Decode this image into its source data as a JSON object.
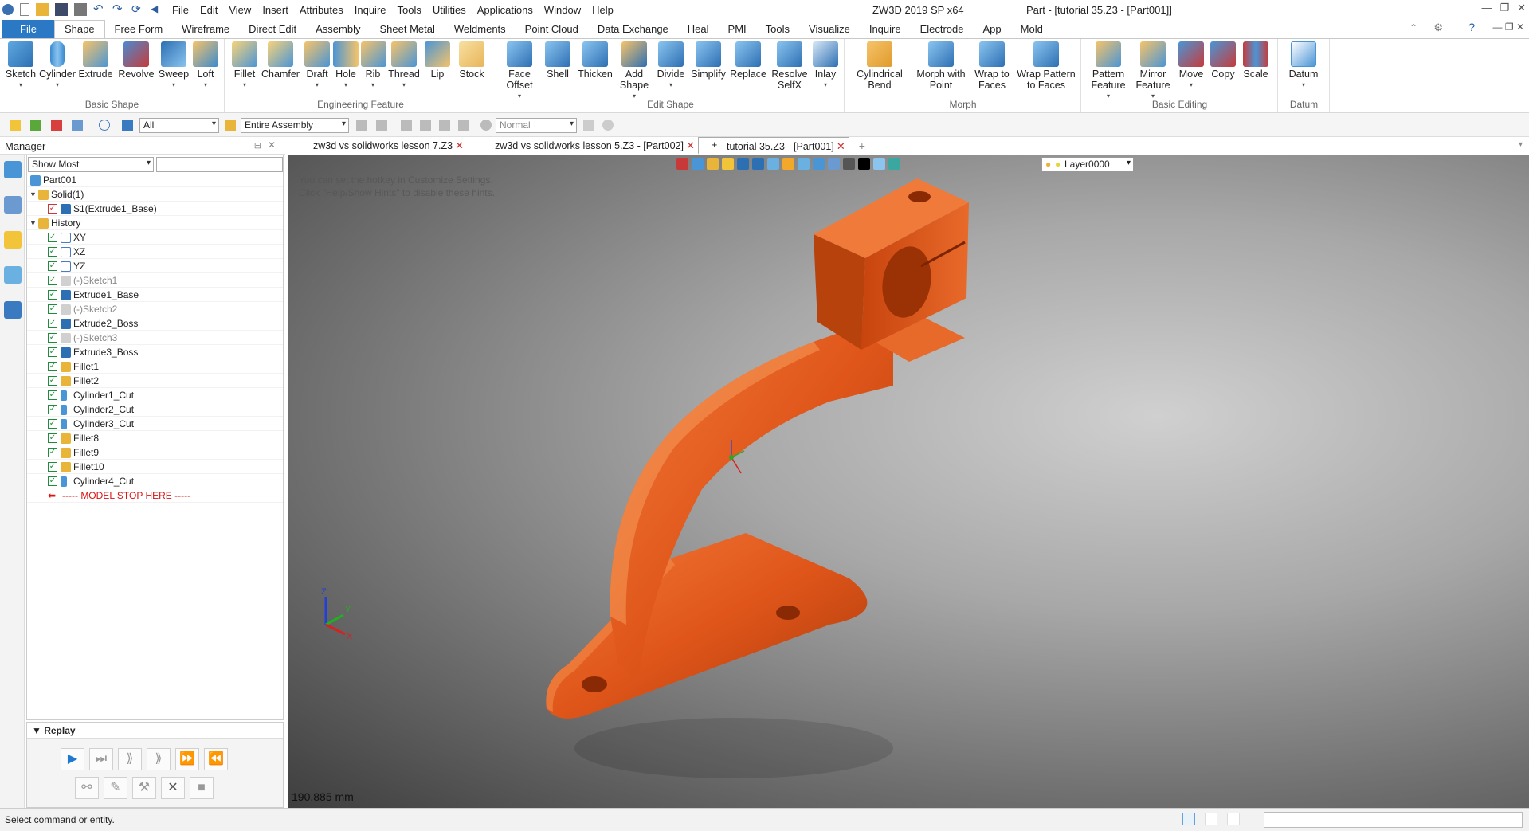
{
  "app": {
    "title": "ZW3D 2019 SP x64",
    "doc_title": "Part - [tutorial 35.Z3 - [Part001]]"
  },
  "menu": [
    "File",
    "Edit",
    "View",
    "Insert",
    "Attributes",
    "Inquire",
    "Tools",
    "Utilities",
    "Applications",
    "Window",
    "Help"
  ],
  "ribbon_tabs": [
    "File",
    "Shape",
    "Free Form",
    "Wireframe",
    "Direct Edit",
    "Assembly",
    "Sheet Metal",
    "Weldments",
    "Point Cloud",
    "Data Exchange",
    "Heal",
    "PMI",
    "Tools",
    "Visualize",
    "Inquire",
    "Electrode",
    "App",
    "Mold"
  ],
  "ribbon_groups": {
    "basic_shape": {
      "label": "Basic Shape",
      "buttons": [
        "Sketch",
        "Cylinder",
        "Extrude",
        "Revolve",
        "Sweep",
        "Loft"
      ]
    },
    "engineering_feature": {
      "label": "Engineering Feature",
      "buttons": [
        "Fillet",
        "Chamfer",
        "Draft",
        "Hole",
        "Rib",
        "Thread",
        "Lip",
        "Stock"
      ]
    },
    "edit_shape": {
      "label": "Edit Shape",
      "buttons": [
        "Face Offset",
        "Shell",
        "Thicken",
        "Add Shape",
        "Divide",
        "Simplify",
        "Replace",
        "Resolve SelfX",
        "Inlay"
      ]
    },
    "morph": {
      "label": "Morph",
      "buttons": [
        "Cylindrical Bend",
        "Morph with Point",
        "Wrap to Faces",
        "Wrap Pattern to Faces"
      ]
    },
    "basic_editing": {
      "label": "Basic Editing",
      "buttons": [
        "Pattern Feature",
        "Mirror Feature",
        "Move",
        "Copy",
        "Scale"
      ]
    },
    "datum": {
      "label": "Datum",
      "buttons": [
        "Datum"
      ]
    }
  },
  "toolbar": {
    "filter": "All",
    "scope": "Entire Assembly",
    "mode": "Normal"
  },
  "manager": {
    "title": "Manager",
    "show": "Show Most"
  },
  "doc_tabs": [
    "zw3d vs solidworks lesson 7.Z3",
    "zw3d vs solidworks lesson 5.Z3 - [Part002]",
    "tutorial 35.Z3 - [Part001]"
  ],
  "tree": {
    "root": "Part001",
    "solid": "Solid(1)",
    "solid_child": "S1(Extrude1_Base)",
    "history": "History",
    "items": [
      "XY",
      "XZ",
      "YZ",
      "(-)Sketch1",
      "Extrude1_Base",
      "(-)Sketch2",
      "Extrude2_Boss",
      "(-)Sketch3",
      "Extrude3_Boss",
      "Fillet1",
      "Fillet2",
      "Cylinder1_Cut",
      "Cylinder2_Cut",
      "Cylinder3_Cut",
      "Fillet8",
      "Fillet9",
      "Fillet10",
      "Cylinder4_Cut"
    ],
    "stop": "----- MODEL STOP HERE -----"
  },
  "replay": {
    "title": "Replay"
  },
  "viewport": {
    "layer": "Layer0000",
    "hint1": "You can set the hotkey in Customize Settings.",
    "hint2": "Click \"Help/Show Hints\" to disable these hints.",
    "scale": "190.885 mm",
    "axis_z": "Z",
    "axis_y": "Y",
    "axis_x": "X"
  },
  "status": {
    "text": "Select command or entity."
  },
  "colors": {
    "accent": "#2b78c4",
    "part": "#e0561a",
    "check": "#1e8c3a",
    "stop": "#d81414"
  }
}
